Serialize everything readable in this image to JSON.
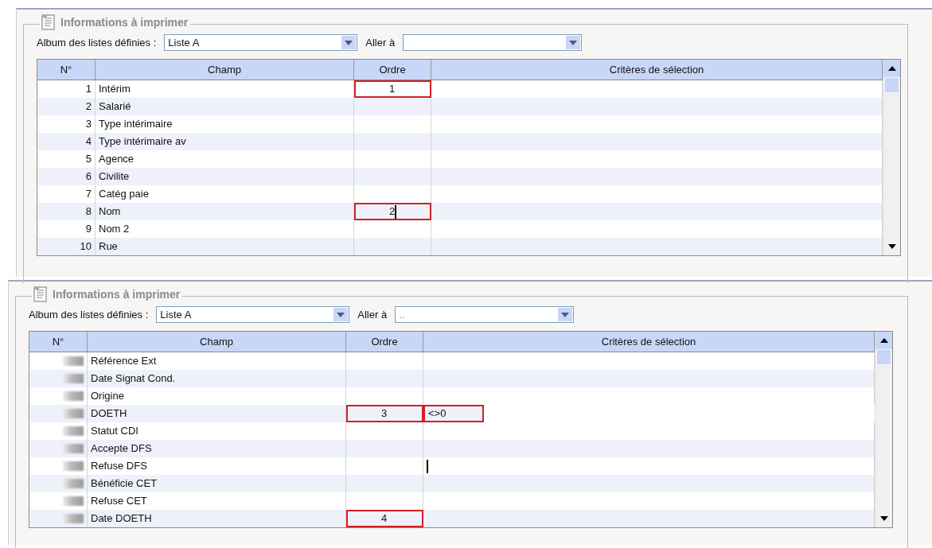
{
  "panels": [
    {
      "title": "Informations à imprimer",
      "album_label": "Album des listes définies :",
      "album_value": "Liste A",
      "goto_label": "Aller à",
      "numbers_blurred": false,
      "columns": [
        "N°",
        "Champ",
        "Ordre",
        "Critères de sélection"
      ],
      "rows": [
        {
          "number": "1",
          "field": "Intérim",
          "order": "1",
          "order_highlighted": true,
          "order_caret": false,
          "criteria_highlighted": false,
          "criteria_caret": false
        },
        {
          "number": "2",
          "field": "Salarié",
          "order_highlighted": false,
          "order_caret": false,
          "criteria_highlighted": false,
          "criteria_caret": false
        },
        {
          "number": "3",
          "field": "Type intérimaire",
          "order_highlighted": false,
          "order_caret": false,
          "criteria_highlighted": false,
          "criteria_caret": false
        },
        {
          "number": "4",
          "field": "Type intérimaire av",
          "order_highlighted": false,
          "order_caret": false,
          "criteria_highlighted": false,
          "criteria_caret": false
        },
        {
          "number": "5",
          "field": "Agence",
          "order_highlighted": false,
          "order_caret": false,
          "criteria_highlighted": false,
          "criteria_caret": false
        },
        {
          "number": "6",
          "field": "Civilite",
          "order_highlighted": false,
          "order_caret": false,
          "criteria_highlighted": false,
          "criteria_caret": false
        },
        {
          "number": "7",
          "field": "Catég paie",
          "order_highlighted": false,
          "order_caret": false,
          "criteria_highlighted": false,
          "criteria_caret": false
        },
        {
          "number": "8",
          "field": "Nom",
          "order": "2",
          "order_highlighted": true,
          "order_caret": true,
          "criteria_highlighted": false,
          "criteria_caret": false
        },
        {
          "number": "9",
          "field": "Nom 2",
          "order_highlighted": false,
          "order_caret": false,
          "criteria_highlighted": false,
          "criteria_caret": false
        },
        {
          "number": "10",
          "field": "Rue",
          "order_highlighted": false,
          "order_caret": false,
          "criteria_highlighted": false,
          "criteria_caret": false
        }
      ]
    },
    {
      "title": "Informations à imprimer",
      "album_label": "Album des listes définies :",
      "album_value": "Liste A",
      "goto_label": "Aller à",
      "goto_value": "..",
      "numbers_blurred": true,
      "columns": [
        "N°",
        "Champ",
        "Ordre",
        "Critères de sélection"
      ],
      "rows": [
        {
          "field": "Référence Ext",
          "order_highlighted": false,
          "order_caret": false,
          "criteria_highlighted": false,
          "criteria_caret": false
        },
        {
          "field": "Date Signat Cond.",
          "order_highlighted": false,
          "order_caret": false,
          "criteria_highlighted": false,
          "criteria_caret": false
        },
        {
          "field": "Origine",
          "order_highlighted": false,
          "order_caret": false,
          "criteria_highlighted": false,
          "criteria_caret": false
        },
        {
          "field": "DOETH",
          "order": "3",
          "order_highlighted": true,
          "order_caret": false,
          "criteria": "<>0",
          "criteria_highlighted": true,
          "criteria_caret": false
        },
        {
          "field": "Statut CDI",
          "order_highlighted": false,
          "order_caret": false,
          "criteria_highlighted": false,
          "criteria_caret": false
        },
        {
          "field": "Accepte DFS",
          "order_highlighted": false,
          "order_caret": false,
          "criteria_highlighted": false,
          "criteria_caret": false
        },
        {
          "field": "Refuse DFS",
          "order_highlighted": false,
          "order_caret": false,
          "criteria_highlighted": false,
          "criteria_caret": true
        },
        {
          "field": "Bénéficie CET",
          "order_highlighted": false,
          "order_caret": false,
          "criteria_highlighted": false,
          "criteria_caret": false
        },
        {
          "field": "Refuse CET",
          "order_highlighted": false,
          "order_caret": false,
          "criteria_highlighted": false,
          "criteria_caret": false
        },
        {
          "field": "Date DOETH",
          "order": "4",
          "order_highlighted": true,
          "order_caret": false,
          "criteria_highlighted": false,
          "criteria_caret": false
        }
      ]
    }
  ]
}
